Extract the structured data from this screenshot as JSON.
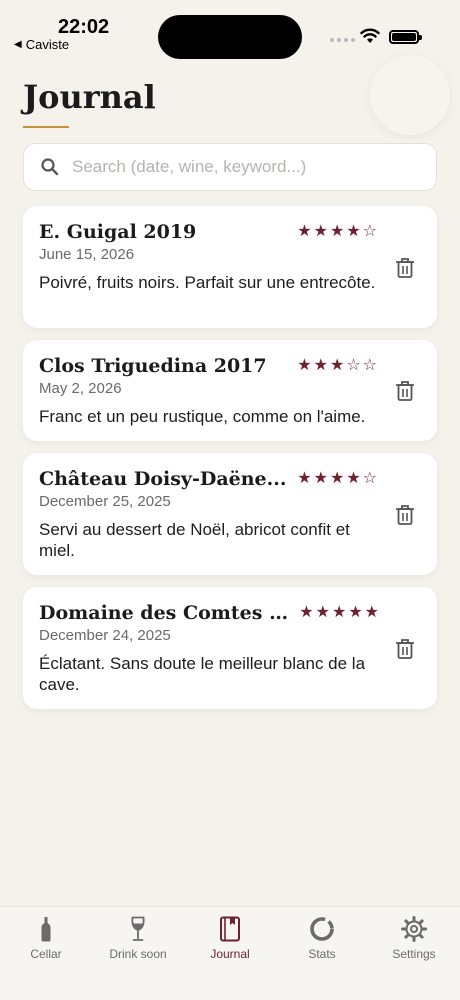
{
  "status_bar": {
    "time": "22:02",
    "back_app": "Caviste"
  },
  "page": {
    "title": "Journal"
  },
  "search": {
    "placeholder": "Search (date, wine, keyword...)"
  },
  "entries": [
    {
      "wine": "E. Guigal 2019",
      "date": "June 15, 2026",
      "rating": 4,
      "stars": "★★★★☆",
      "note": "Poivré, fruits noirs. Parfait sur une entrecôte."
    },
    {
      "wine": "Clos Triguedina 2017",
      "date": "May 2, 2026",
      "rating": 3,
      "stars": "★★★☆☆",
      "note": "Franc et un peu rustique, comme on l'aime."
    },
    {
      "wine": "Château Doisy-Daëne...",
      "date": "December 25, 2025",
      "rating": 4,
      "stars": "★★★★☆",
      "note": "Servi au dessert de Noël, abricot confit et miel."
    },
    {
      "wine": "Domaine des Comtes L...",
      "date": "December 24, 2025",
      "rating": 5,
      "stars": "★★★★★",
      "note": "Éclatant. Sans doute le meilleur blanc de la cave."
    }
  ],
  "tabs": [
    {
      "label": "Cellar",
      "icon": "bottle-icon"
    },
    {
      "label": "Drink soon",
      "icon": "wine-glass-icon"
    },
    {
      "label": "Journal",
      "icon": "journal-icon",
      "active": true
    },
    {
      "label": "Stats",
      "icon": "ring-chart-icon"
    },
    {
      "label": "Settings",
      "icon": "gear-icon"
    }
  ],
  "colors": {
    "accent": "#6e2230",
    "gold": "#c8923a",
    "background": "#f5f2ec"
  }
}
